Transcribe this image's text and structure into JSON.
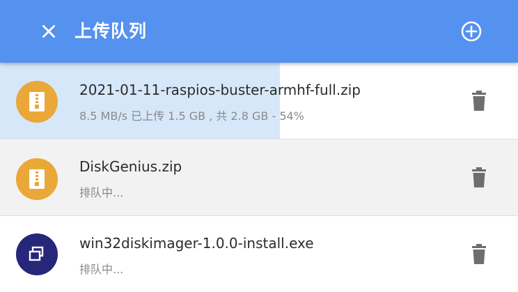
{
  "header": {
    "title": "上传队列",
    "background": "#5591ee"
  },
  "uploads": [
    {
      "name": "2021-01-11-raspios-buster-armhf-full.zip",
      "status": "8.5 MB/s 已上传 1.5 GB , 共 2.8 GB - 54%",
      "progress": 0.54,
      "icon": "zip-file-icon"
    },
    {
      "name": "DiskGenius.zip",
      "status": "排队中...",
      "icon": "zip-file-icon"
    },
    {
      "name": "win32diskimager-1.0.0-install.exe",
      "status": "排队中...",
      "icon": "exe-file-icon"
    }
  ],
  "colors": {
    "accent": "#5591ee",
    "zip": "#e9a837",
    "exe": "#26277a",
    "progress": "#d6e7fa"
  }
}
